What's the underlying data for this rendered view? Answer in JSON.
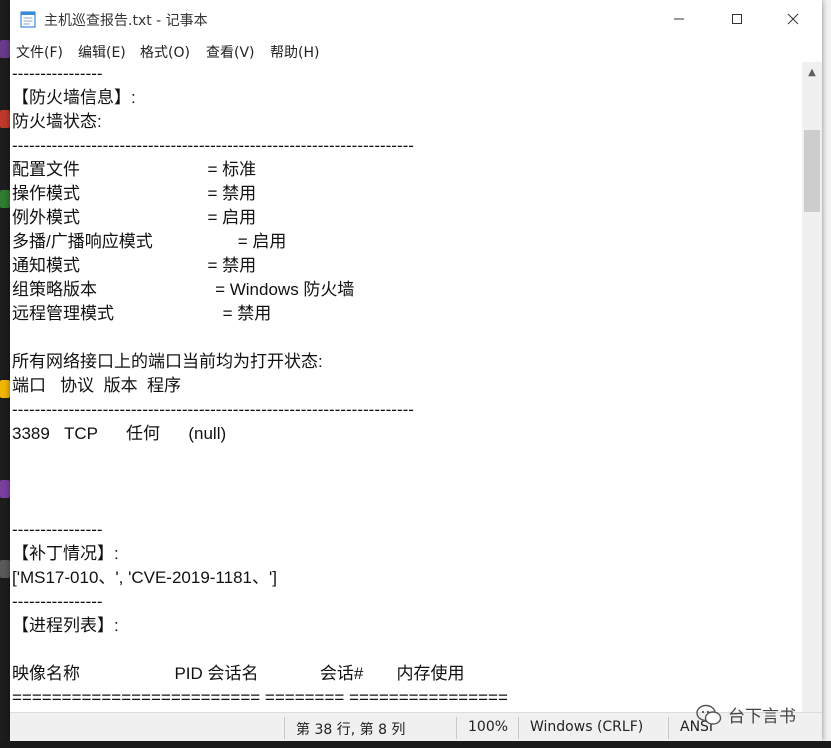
{
  "window": {
    "title": "主机巡查报告.txt - 记事本"
  },
  "menu": [
    "文件(F)",
    "编辑(E)",
    "格式(O)",
    "查看(V)",
    "帮助(H)"
  ],
  "content": {
    "lines": [
      "----------------",
      "【防火墙信息】:",
      "防火墙状态:",
      "-----------------------------------------------------------------------",
      "配置文件                           = 标准",
      "操作模式                           = 禁用",
      "例外模式                           = 启用",
      "多播/广播响应模式                  = 启用",
      "通知模式                           = 禁用",
      "组策略版本                         = Windows 防火墙",
      "远程管理模式                       = 禁用",
      "",
      "所有网络接口上的端口当前均为打开状态:",
      "端口   协议  版本  程序",
      "-----------------------------------------------------------------------",
      "3389   TCP      任何      (null)",
      "",
      "",
      "",
      "----------------",
      "【补丁情况】:",
      "['MS17-010、', 'CVE-2019-1181、']",
      "----------------",
      "【进程列表】:",
      "",
      "映像名称                    PID 会话名             会话#       内存使用",
      "========================= ======== ================",
      "=========== ============"
    ]
  },
  "status": {
    "position": "第 38 行, 第 8 列",
    "zoom": "100%",
    "line_ending": "Windows (CRLF)",
    "encoding": "ANSI"
  },
  "watermark": {
    "text": "台下言书"
  },
  "colors": {
    "accent_icon": "#3a8ad8",
    "background": "#ffffff",
    "statusbar": "#f0f0f0"
  }
}
